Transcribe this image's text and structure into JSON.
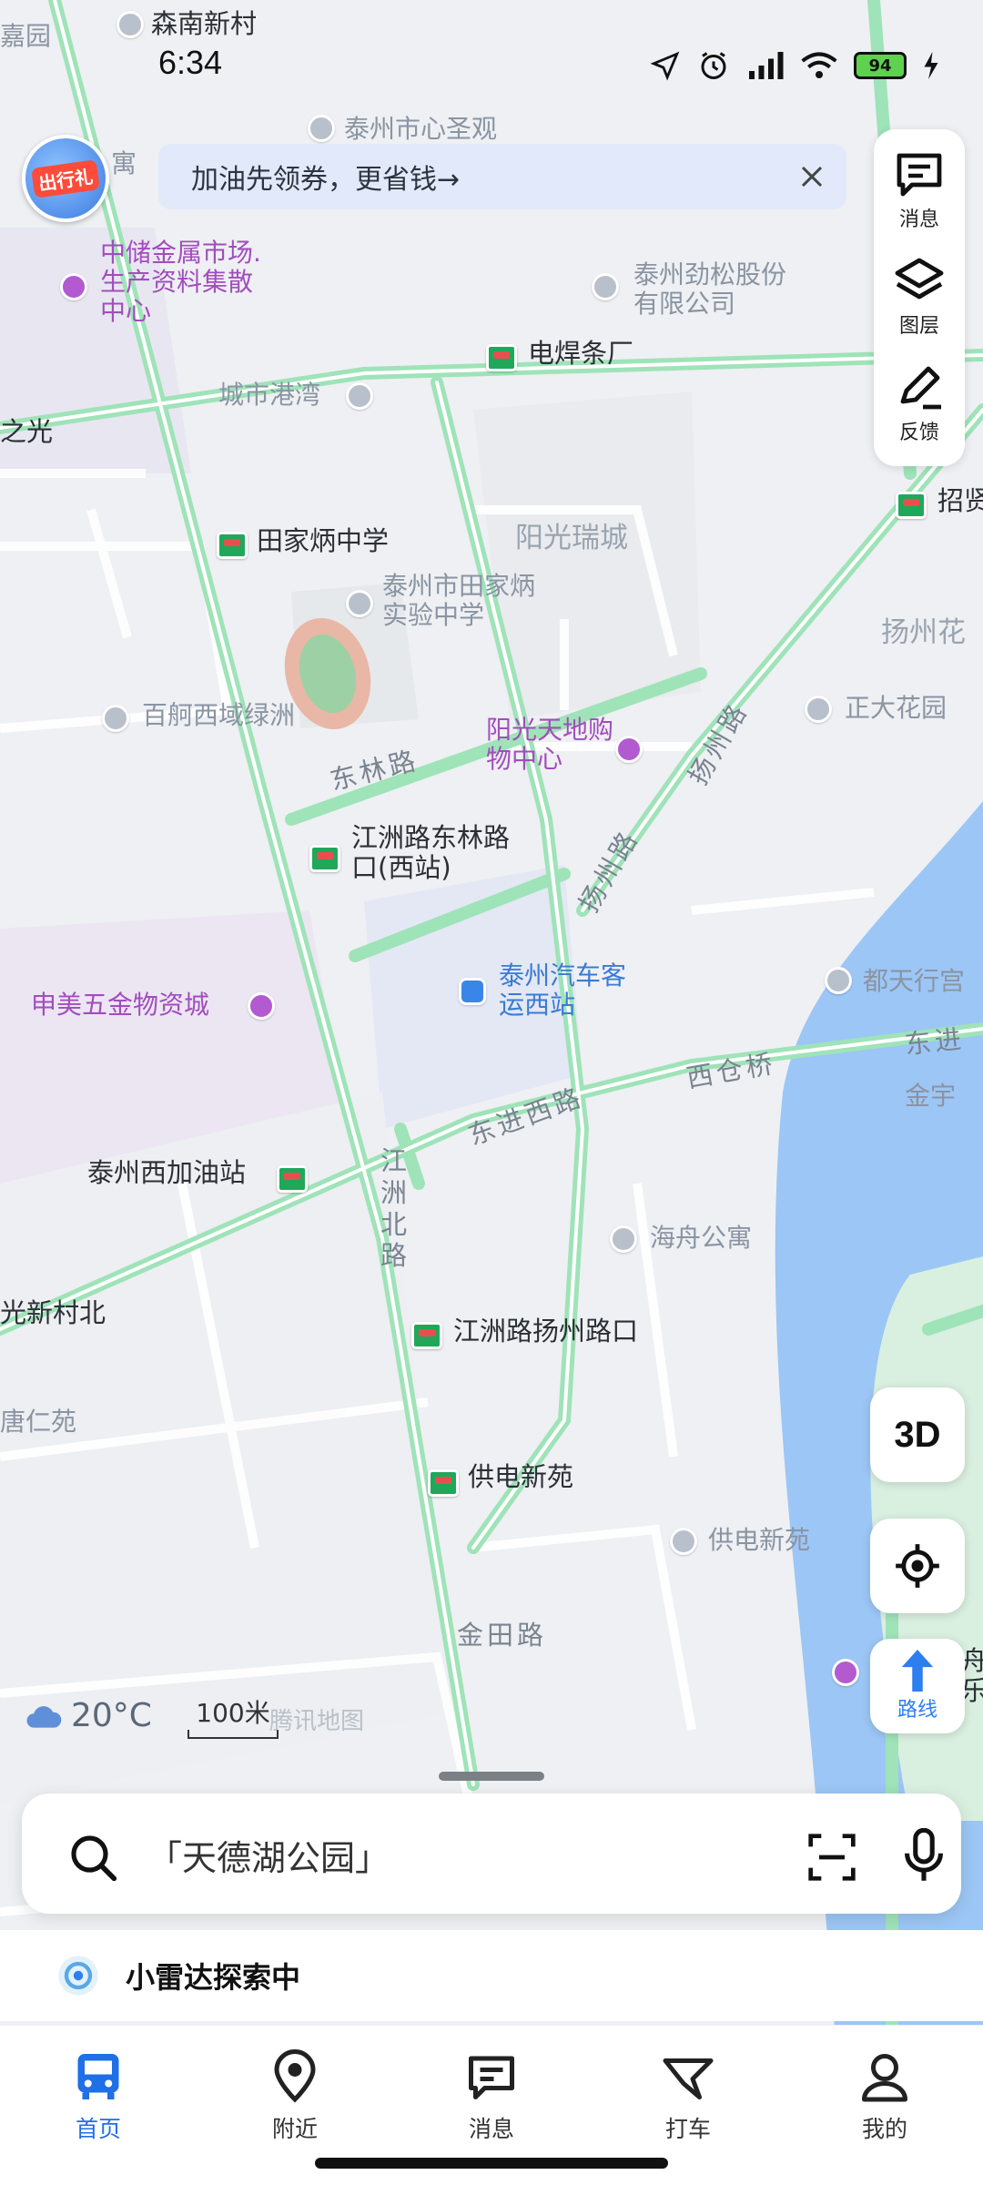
{
  "status_bar": {
    "time": "6:34",
    "battery": "94"
  },
  "promo": {
    "gift_label": "出行礼",
    "text": "加油先领券，更省钱→"
  },
  "toolbar": {
    "messages": "消息",
    "layers": "图层",
    "feedback": "反馈"
  },
  "map_labels": {
    "senan": "森南新村",
    "jiayuan": "嘉园",
    "yu": "寓",
    "shengguan": "泰州市心圣观",
    "zhongchu": "中储金属市场.生产资料集散中心",
    "jinsong": "泰州劲松股份有限公司",
    "weld": "电焊条厂",
    "gangwan": "城市港湾",
    "zhiguang": "之光",
    "tianjia_school": "田家炳中学",
    "tianjia_exp": "泰州市田家炳实验中学",
    "yangguang_ruicheng": "阳光瑞城",
    "baixi": "百舸西域绿洲",
    "yangguang_mall": "阳光天地购物中心",
    "donglin": "东林路",
    "jiangzhou_donglin": "江洲路东林路口(西站)",
    "zhengda": "正大花园",
    "yangzhou_hua": "扬州花",
    "zhaoxian": "招贤",
    "zhongmei": "申美五金物资城",
    "west_station": "泰州汽车客运西站",
    "dutian": "都天行宫",
    "dongjin": "东进",
    "jinyu": "金宇",
    "xicang": "西仓桥",
    "dongjin_west": "东进西路",
    "gas_station": "泰州西加油站",
    "jiangzhou_north": "江洲北路",
    "haizhou": "海舟公寓",
    "guangxin": "光新村北",
    "jiangzhou_yangzhou": "江洲路扬州路口",
    "tangren": "唐仁苑",
    "gongdian_stop": "供电新苑",
    "gongdian": "供电新苑",
    "jintian": "金田路",
    "yangzhou_road": "扬州路",
    "yangzhou_road2": "扬州路",
    "zhou": "舟乐"
  },
  "controls": {
    "three_d": "3D",
    "route": "路线"
  },
  "weather": {
    "temp": "20°C"
  },
  "scale": {
    "label": "100米"
  },
  "watermark": "腾讯地图",
  "search": {
    "placeholder": "「天德湖公园」"
  },
  "radar": {
    "text": "小雷达探索中"
  },
  "nav": [
    {
      "label": "首页"
    },
    {
      "label": "附近"
    },
    {
      "label": "消息"
    },
    {
      "label": "打车"
    },
    {
      "label": "我的"
    }
  ],
  "colors": {
    "road": "#9fe3b8",
    "river": "#9cc6f5",
    "accent": "#1f6fe6"
  }
}
